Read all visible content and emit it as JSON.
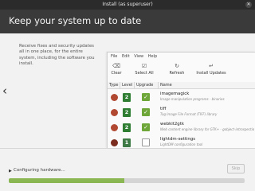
{
  "window": {
    "title": "Install (as superuser)"
  },
  "header": {
    "title": "Keep your system up to date"
  },
  "slide": {
    "description": "Receive fixes and security updates all in one place, for the entire system, including the software you install."
  },
  "update_manager": {
    "menu": [
      "File",
      "Edit",
      "View",
      "Help"
    ],
    "toolbar": {
      "clear": "Clear",
      "select_all": "Select All",
      "refresh": "Refresh",
      "install": "Install Updates"
    },
    "columns": [
      "Type",
      "Level",
      "Upgrade",
      "Name"
    ],
    "rows": [
      {
        "level": "2",
        "checked": true,
        "name": "imagemagick",
        "desc": "Image manipulation programs - binaries"
      },
      {
        "level": "2",
        "checked": true,
        "name": "tiff",
        "desc": "Tag Image File Format (TIFF) library"
      },
      {
        "level": "2",
        "checked": true,
        "name": "webkit2gtk",
        "desc": "Web content engine library for GTK+ - gobject-introspection"
      },
      {
        "level": "1",
        "checked": false,
        "name": "lightdm-settings",
        "desc": "LightDM configuration tool"
      }
    ]
  },
  "status": {
    "text": "Configuring hardware...",
    "skip_label": "Skip",
    "progress": 0.49
  },
  "colors": {
    "accent": "#8bb753",
    "header": "#3a3a3a"
  }
}
